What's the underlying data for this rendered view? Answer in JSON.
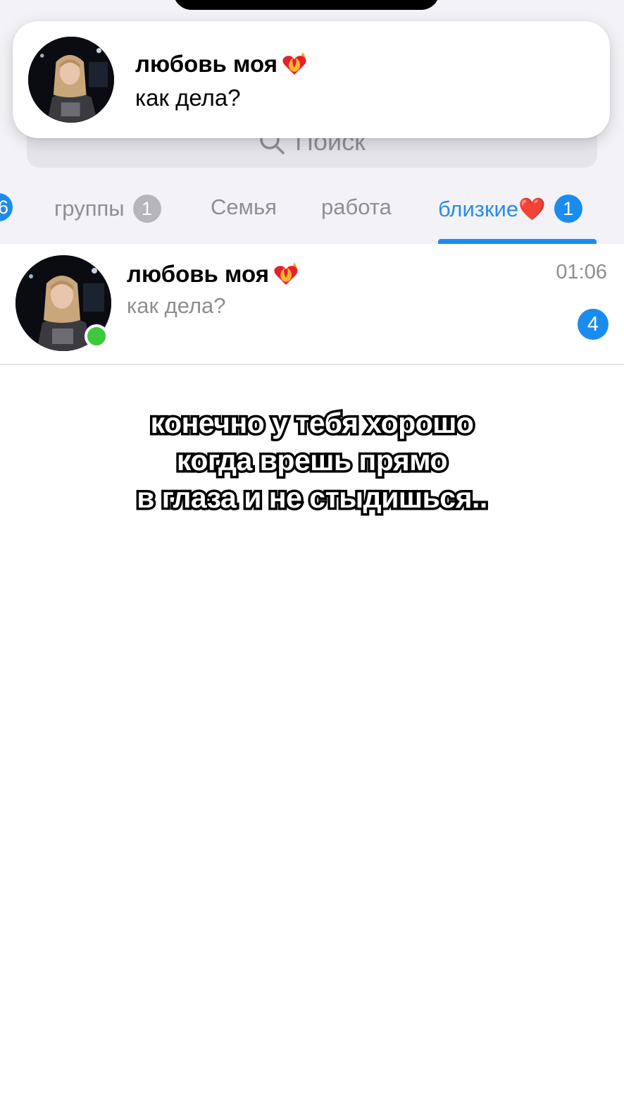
{
  "notification": {
    "sender": "любовь моя",
    "message": "как дела?",
    "sender_emoji_icon": "heart-on-fire-icon"
  },
  "search": {
    "placeholder": "Поиск"
  },
  "tabs": [
    {
      "label": "6",
      "active": false,
      "partial": true
    },
    {
      "label": "группы",
      "badge": "1",
      "active": false
    },
    {
      "label": "Семья",
      "active": false
    },
    {
      "label": "работа",
      "active": false
    },
    {
      "label": "близкие❤️",
      "badge": "1",
      "active": true
    }
  ],
  "chat": {
    "name": "любовь моя",
    "preview": "как дела?",
    "time": "01:06",
    "unread": "4",
    "online": true
  },
  "caption": {
    "line1": "конечно у тебя хорошо",
    "line2": "когда врешь прямо",
    "line3": "в глаза и не стыдишься.."
  },
  "colors": {
    "accent": "#1a8cf0",
    "online": "#3cc93c",
    "header_bg": "#f2f2f7"
  }
}
